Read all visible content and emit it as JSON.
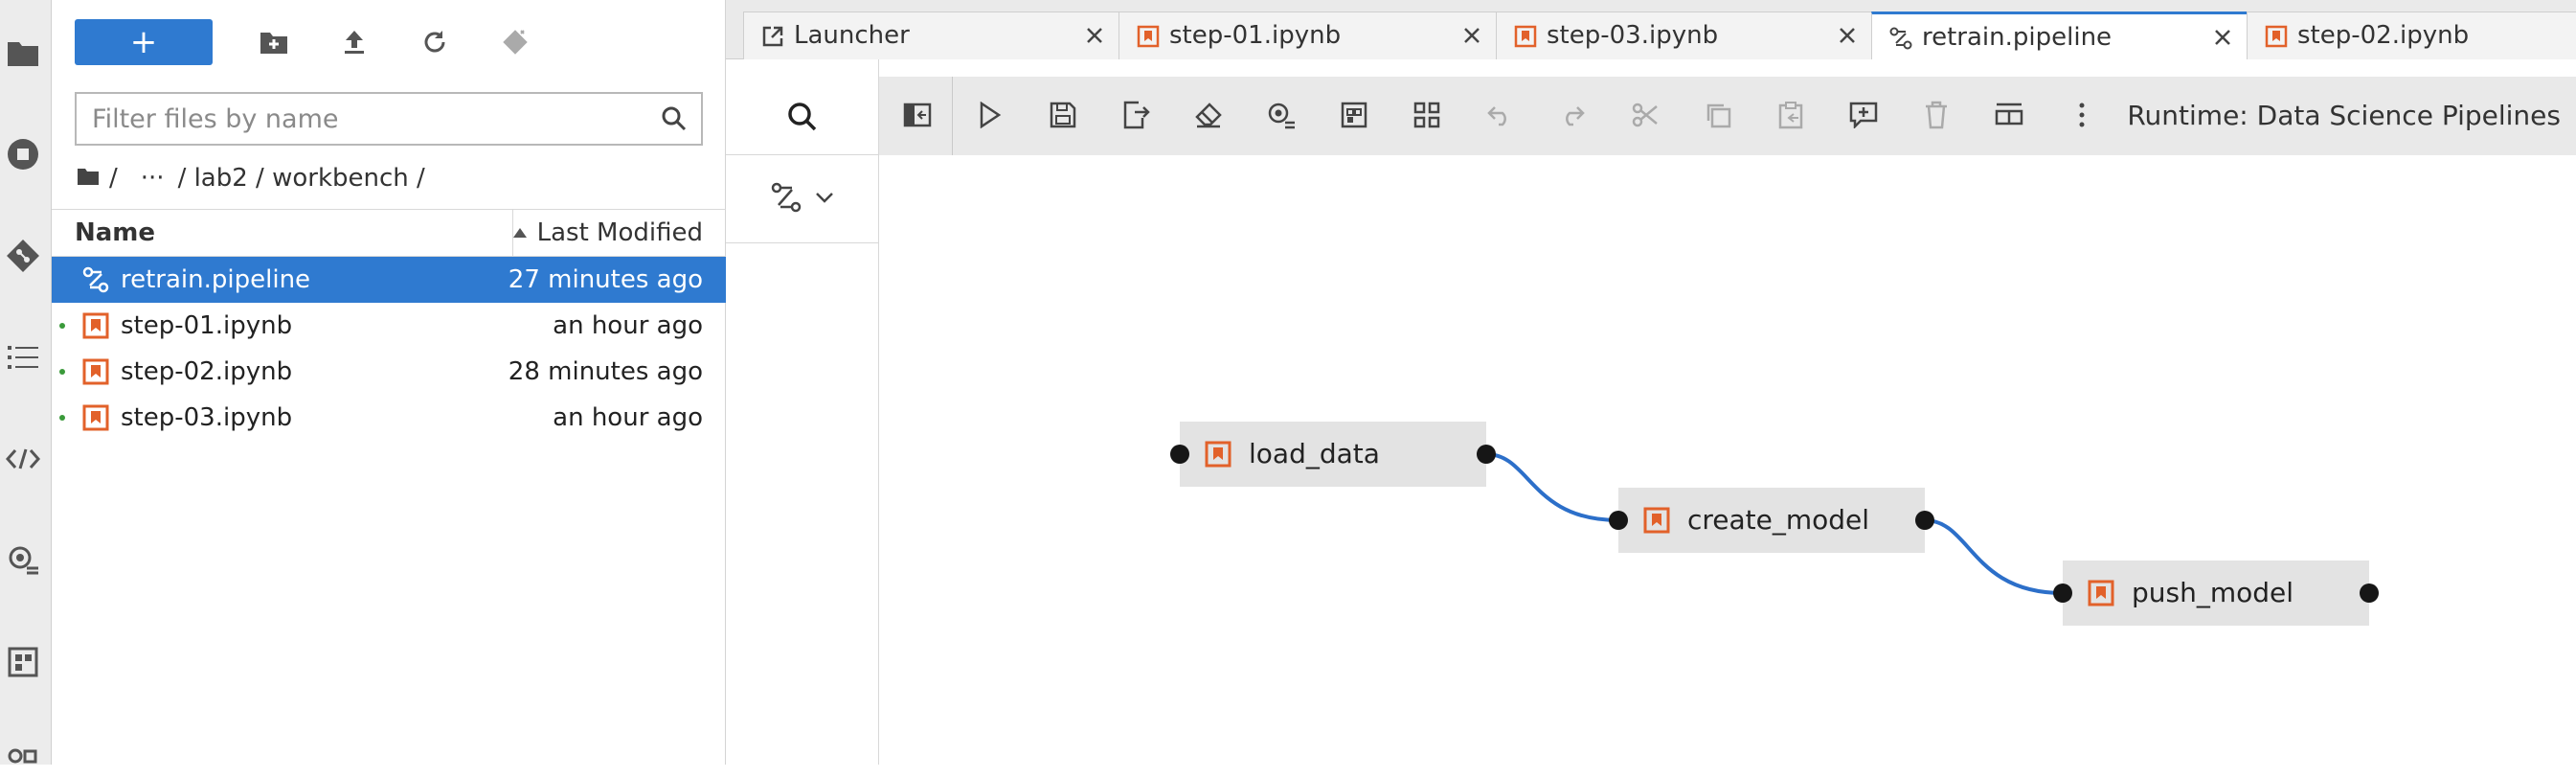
{
  "file_browser": {
    "new_button_label": "+",
    "filter_placeholder": "Filter files by name",
    "breadcrumb": {
      "root": "/",
      "ellipsis": "···",
      "path": "/ lab2 / workbench /"
    },
    "columns": {
      "name": "Name",
      "modified": "Last Modified"
    },
    "files": [
      {
        "name": "retrain.pipeline",
        "modified": "27 minutes ago",
        "type": "pipeline",
        "selected": true
      },
      {
        "name": "step-01.ipynb",
        "modified": "an hour ago",
        "type": "notebook",
        "running": true
      },
      {
        "name": "step-02.ipynb",
        "modified": "28 minutes ago",
        "type": "notebook",
        "running": true
      },
      {
        "name": "step-03.ipynb",
        "modified": "an hour ago",
        "type": "notebook",
        "running": true
      }
    ]
  },
  "tabs": [
    {
      "label": "Launcher",
      "icon": "launcher-icon"
    },
    {
      "label": "step-01.ipynb",
      "icon": "notebook-icon"
    },
    {
      "label": "step-03.ipynb",
      "icon": "notebook-icon"
    },
    {
      "label": "retrain.pipeline",
      "icon": "pipeline-icon",
      "active": true
    },
    {
      "label": "step-02.ipynb",
      "icon": "notebook-icon"
    }
  ],
  "editor": {
    "runtime_label": "Runtime: Data Science Pipelines",
    "nodes": [
      {
        "label": "load_data"
      },
      {
        "label": "create_model"
      },
      {
        "label": "push_model"
      }
    ]
  },
  "colors": {
    "accent": "#2f7ad0",
    "notebook_icon": "#e2612a",
    "link": "#2c6fc9",
    "node_bg": "#e3e3e3",
    "running_dot": "#3a9a3a"
  }
}
